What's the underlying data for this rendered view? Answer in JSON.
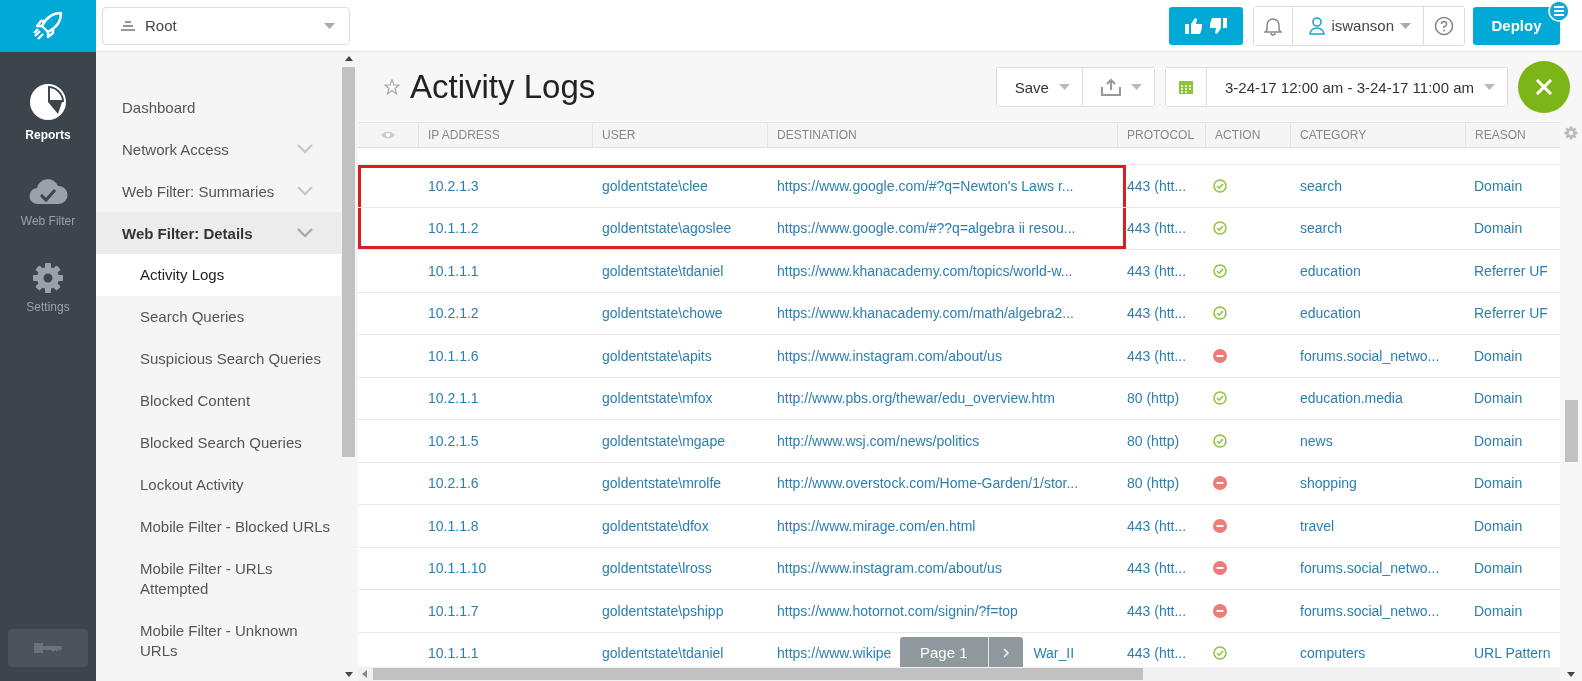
{
  "rail": {
    "items": [
      {
        "label": "Reports",
        "kind": "pie",
        "selected": true
      },
      {
        "label": "Web Filter",
        "kind": "cloud",
        "selected": false
      },
      {
        "label": "Settings",
        "kind": "gear",
        "selected": false
      }
    ]
  },
  "topbar": {
    "scope": "Root",
    "user": "iswanson",
    "deploy": "Deploy"
  },
  "sidebar": {
    "items": [
      {
        "label": "Dashboard",
        "selected": false
      },
      {
        "label": "Network Access",
        "selected": false,
        "expanded": false
      },
      {
        "label": "Web Filter: Summaries",
        "selected": false,
        "expanded": false
      },
      {
        "label": "Web Filter: Details",
        "selected": false,
        "expanded": true,
        "children": [
          {
            "label": "Activity Logs",
            "selected": true
          },
          {
            "label": "Search Queries",
            "selected": false
          },
          {
            "label": "Suspicious Search Queries",
            "selected": false
          },
          {
            "label": "Blocked Content",
            "selected": false
          },
          {
            "label": "Blocked Search Queries",
            "selected": false
          },
          {
            "label": "Lockout Activity",
            "selected": false
          },
          {
            "label": "Mobile Filter - Blocked URLs",
            "selected": false
          },
          {
            "label": "Mobile Filter - URLs Attempted",
            "selected": false
          },
          {
            "label": "Mobile Filter - Unknown URLs",
            "selected": false
          }
        ]
      }
    ]
  },
  "page": {
    "title": "Activity Logs",
    "save": "Save",
    "date_range": "3-24-17 12:00 am - 3-24-17 11:00 am"
  },
  "table": {
    "columns": [
      "IP ADDRESS",
      "USER",
      "DESTINATION",
      "PROTOCOL",
      "ACTION",
      "CATEGORY",
      "REASON"
    ],
    "rows": [
      {
        "ip": "10.2.1.3",
        "user": "goldentstate\\clee",
        "destination": "https://www.google.com/#?q=Newton's Laws r...",
        "protocol": "443 (htt...",
        "kind": "allowed",
        "category": "search",
        "reason": "Domain",
        "highlighted": true
      },
      {
        "ip": "10.1.1.2",
        "user": "goldentstate\\agoslee",
        "destination": "https://www.google.com/#??q=algebra ii resou...",
        "protocol": "443 (htt...",
        "kind": "allowed",
        "category": "search",
        "reason": "Domain",
        "highlighted": true
      },
      {
        "ip": "10.1.1.1",
        "user": "goldentstate\\tdaniel",
        "destination": "https://www.khanacademy.com/topics/world-w...",
        "protocol": "443 (htt...",
        "kind": "allowed",
        "category": "education",
        "reason": "Referrer UF",
        "highlighted": false
      },
      {
        "ip": "10.2.1.2",
        "user": "goldentstate\\chowe",
        "destination": "https://www.khanacademy.com/math/algebra2...",
        "protocol": "443 (htt...",
        "kind": "allowed",
        "category": "education",
        "reason": "Referrer UF",
        "highlighted": false
      },
      {
        "ip": "10.1.1.6",
        "user": "goldentstate\\apits",
        "destination": "https://www.instagram.com/about/us",
        "protocol": "443 (htt...",
        "kind": "blocked",
        "category": "forums.social_netwo...",
        "reason": "Domain",
        "highlighted": false
      },
      {
        "ip": "10.2.1.1",
        "user": "goldentstate\\mfox",
        "destination": "http://www.pbs.org/thewar/edu_overview.htm",
        "protocol": "80 (http)",
        "kind": "allowed",
        "category": "education.media",
        "reason": "Domain",
        "highlighted": false
      },
      {
        "ip": "10.2.1.5",
        "user": "goldentstate\\mgape",
        "destination": "http://www.wsj.com/news/politics",
        "protocol": "80 (http)",
        "kind": "allowed",
        "category": "news",
        "reason": "Domain",
        "highlighted": false
      },
      {
        "ip": "10.2.1.6",
        "user": "goldentstate\\mrolfe",
        "destination": "http://www.overstock.com/Home-Garden/1/stor...",
        "protocol": "80 (http)",
        "kind": "blocked",
        "category": "shopping",
        "reason": "Domain",
        "highlighted": false
      },
      {
        "ip": "10.1.1.8",
        "user": "goldentstate\\dfox",
        "destination": "https://www.mirage.com/en.html",
        "protocol": "443 (htt...",
        "kind": "blocked",
        "category": "travel",
        "reason": "Domain",
        "highlighted": false
      },
      {
        "ip": "10.1.1.10",
        "user": "goldentstate\\lross",
        "destination": "https://www.instagram.com/about/us",
        "protocol": "443 (htt...",
        "kind": "blocked",
        "category": "forums.social_netwo...",
        "reason": "Domain",
        "highlighted": false
      },
      {
        "ip": "10.1.1.7",
        "user": "goldentstate\\pshipp",
        "destination": "https://www.hotornot.com/signin/?f=top",
        "protocol": "443 (htt...",
        "kind": "blocked",
        "category": "forums.social_netwo...",
        "reason": "Domain",
        "highlighted": false
      },
      {
        "ip": "10.1.1.1",
        "user": "goldentstate\\tdaniel",
        "destination": "https://www.wikipe",
        "destination_tail": "War_II",
        "protocol": "443 (htt...",
        "kind": "allowed",
        "category": "computers",
        "reason": "URL Pattern",
        "highlighted": false
      }
    ]
  },
  "pager": {
    "label": "Page 1"
  }
}
